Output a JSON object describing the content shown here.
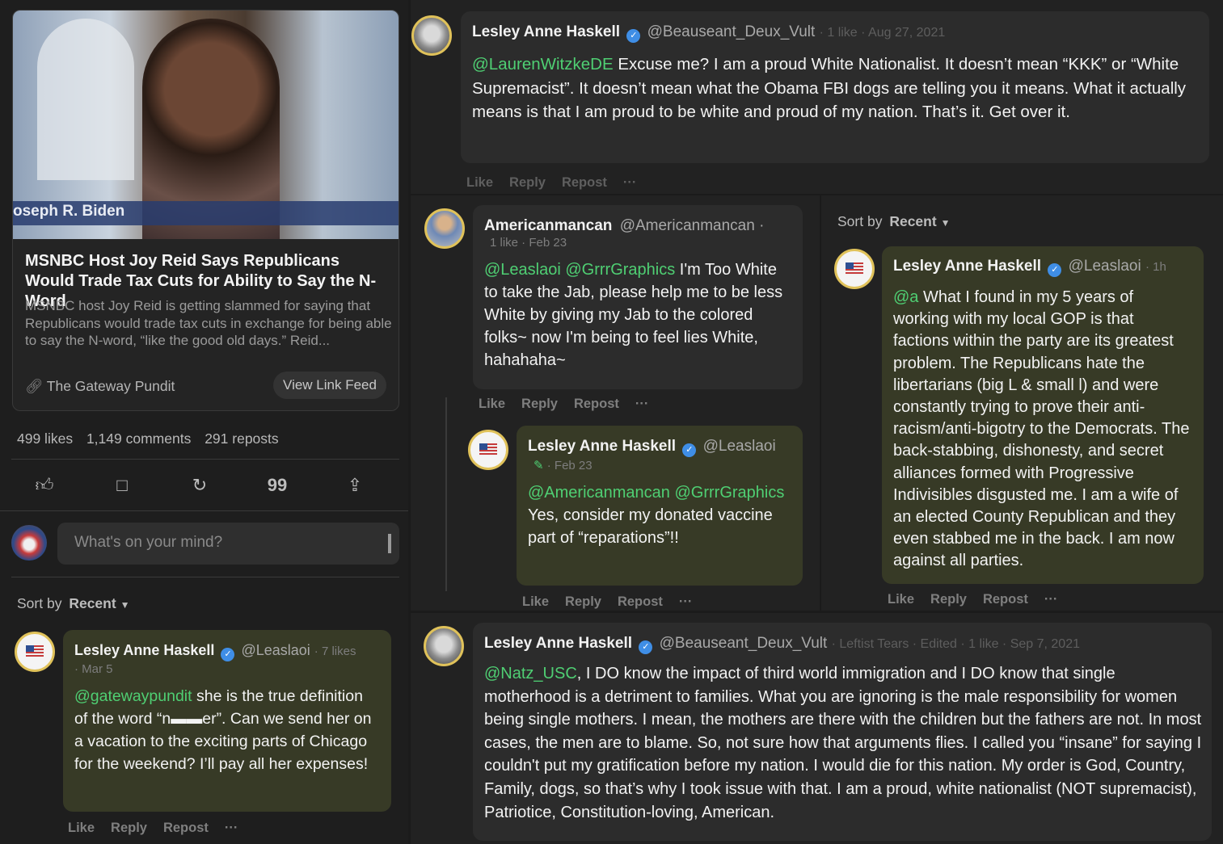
{
  "article": {
    "image_caption": "oseph R. Biden",
    "title": "MSNBC Host Joy Reid Says Republicans Would Trade Tax Cuts for Ability to Say the N-Word",
    "description": "MSNBC host Joy Reid is getting slammed for saying that Republicans would trade tax cuts in exchange for being able to say the N-word, “like the good old days.” Reid...",
    "source": "The Gateway Pundit",
    "view_button": "View Link Feed",
    "stats": {
      "likes": "499 likes",
      "comments": "1,149 comments",
      "reposts": "291 reposts"
    }
  },
  "composer": {
    "placeholder": "What's on your mind?"
  },
  "sort": {
    "label": "Sort by",
    "value": "Recent"
  },
  "actions": {
    "like": "Like",
    "reply": "Reply",
    "repost": "Repost",
    "more": "···"
  },
  "comments": {
    "left_main": {
      "name": "Lesley Anne Haskell",
      "handle": "@Leaslaoi",
      "meta1": "· 7 likes",
      "meta2": "· Mar 5",
      "mention": "@gatewaypundit",
      "text": " she is the true definition of the word “n▬▬er”. Can we send her on a vacation to the exciting parts of Chicago for the weekend? I’ll pay all her expenses!"
    },
    "top_right": {
      "name": "Lesley Anne Haskell",
      "handle": "@Beauseant_Deux_Vult",
      "meta": "· 1 like · Aug 27, 2021",
      "mention": "@LaurenWitzkeDE",
      "text": " Excuse me? I am a proud White Nationalist. It doesn’t mean “KKK” or “White Supremacist”. It doesn’t mean what the Obama FBI dogs are telling you it means. What it actually means is that I am proud to be white and proud of my nation. That’s it. Get over it."
    },
    "middle": {
      "name": "Americanmancan",
      "handle": "@Americanmancan ·",
      "meta": "1 like · Feb 23",
      "mention": "@Leaslaoi @GrrrGraphics",
      "text": " I'm Too White to take the Jab, please help me to be less White by giving my Jab to the colored folks~ now I'm being to feel lies White, hahahaha~"
    },
    "middle_reply": {
      "name": "Lesley Anne Haskell",
      "handle": "@Leaslaoi",
      "meta": "· Feb 23",
      "mention": "@Americanmancan @GrrrGraphics",
      "text": " Yes, consider my donated vaccine part of “reparations”!!"
    },
    "right_thread": {
      "name": "Lesley Anne Haskell",
      "handle": "@Leaslaoi",
      "meta": "· 1h",
      "mention": "@a",
      "text": " What I found in my 5 years of working with my local GOP is that factions within the party are its greatest problem. The Republicans hate the libertarians (big L & small l) and were constantly trying to prove their anti-racism/anti-bigotry to the Democrats. The back-stabbing, dishonesty, and secret alliances formed with Progressive Indivisibles disgusted me. I am a wife of an elected County Republican and they even stabbed me in the back. I am now against all parties."
    },
    "bottom": {
      "name": "Lesley Anne Haskell",
      "handle": "@Beauseant_Deux_Vult",
      "meta": "· Leftist Tears · Edited · 1 like · Sep 7, 2021",
      "mention": "@Natz_USC",
      "text": ", I DO know the impact of third world immigration and I DO know that single motherhood is a detriment to families. What you are ignoring is the male responsibility for women being single mothers. I mean, the mothers are there with the children but the fathers are not. In most cases, the men are to blame. So, not sure how that arguments flies. I called you “insane” for saying I couldn't put my gratification before my nation. I would die for this nation. My order is God, Country, Family, dogs, so that’s why I took issue with that. I am a proud, white nationalist (NOT supremacist), Patriotice, Constitution-loving, American."
    }
  }
}
